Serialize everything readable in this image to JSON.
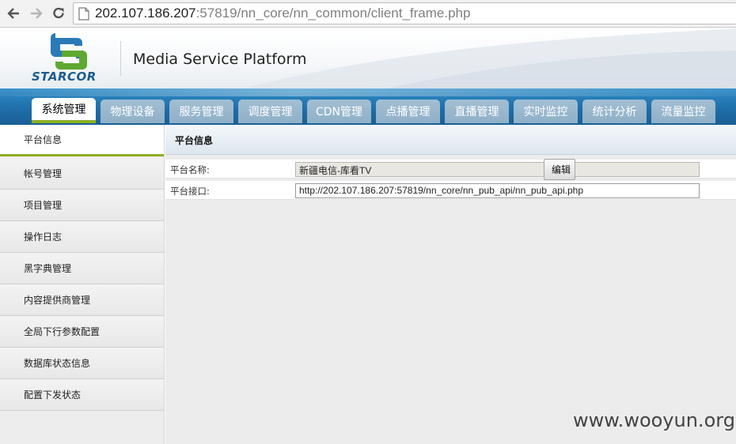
{
  "browser": {
    "back_icon": "arrow-left-icon",
    "forward_icon": "arrow-right-icon",
    "reload_icon": "reload-icon",
    "url_host": "202.107.186.207",
    "url_rest": ":57819/nn_core/nn_common/client_frame.php"
  },
  "header": {
    "logo_text": "STARCOR",
    "title": "Media Service Platform"
  },
  "nav": {
    "tabs": [
      {
        "label": "系统管理",
        "active": true
      },
      {
        "label": "物理设备"
      },
      {
        "label": "服务管理"
      },
      {
        "label": "调度管理"
      },
      {
        "label": "CDN管理"
      },
      {
        "label": "点播管理"
      },
      {
        "label": "直播管理"
      },
      {
        "label": "实时监控"
      },
      {
        "label": "统计分析"
      },
      {
        "label": "流量监控"
      }
    ]
  },
  "sidebar": {
    "items": [
      {
        "label": "平台信息",
        "active": true
      },
      {
        "label": "帐号管理"
      },
      {
        "label": "项目管理"
      },
      {
        "label": "操作日志"
      },
      {
        "label": "黑字典管理"
      },
      {
        "label": "内容提供商管理"
      },
      {
        "label": "全局下行参数配置"
      },
      {
        "label": "数据库状态信息"
      },
      {
        "label": "配置下发状态"
      }
    ]
  },
  "main": {
    "title": "平台信息",
    "rows": [
      {
        "label": "平台名称:",
        "value": "新疆电信-库看TV"
      },
      {
        "label": "平台接口:",
        "value": "http://202.107.186.207:57819/nn_core/nn_pub_api/nn_pub_api.php"
      }
    ],
    "edit_label": "编辑"
  },
  "watermark": "www.wooyun.org",
  "colors": {
    "nav_blue": "#1f6fa9",
    "accent_green": "#8daf26",
    "tab_inactive": "#8fb0c8"
  }
}
